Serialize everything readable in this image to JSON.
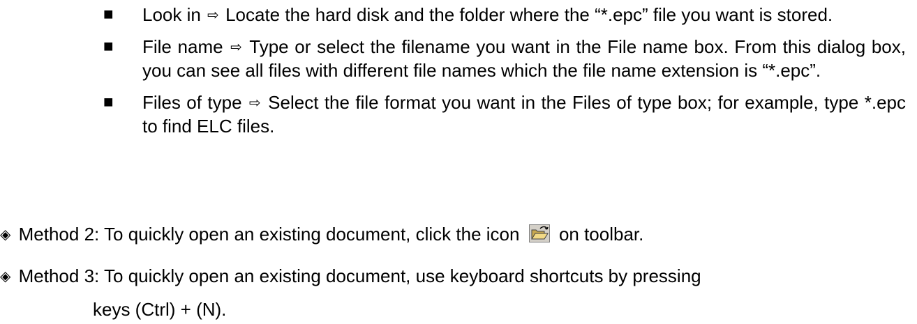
{
  "bullets": [
    {
      "term": "Look in",
      "arrow": "⇨",
      "text": "Locate the hard disk and the folder where the “*.epc” file you want is stored."
    },
    {
      "term": "File name",
      "arrow": "⇨",
      "text": "Type or select the filename you want in the File name box. From this dialog box, you can see all files with different file names which the file name extension is “*.epc”."
    },
    {
      "term": "Files of type",
      "arrow": "⇨",
      "text": "Select the file format you want in the Files of type box; for example, type *.epc to find ELC files."
    }
  ],
  "bullet_symbol": "■",
  "diamond_symbol": "◈",
  "method2": {
    "label": "Method 2:",
    "text_before_icon": "To quickly open an existing document, click the icon",
    "text_after_icon": "on toolbar.",
    "icon": "open-folder-icon"
  },
  "method3": {
    "label": "Method 3:",
    "text": "To quickly open an existing document, use keyboard shortcuts by pressing",
    "continuation": "keys (Ctrl) + (N)."
  }
}
